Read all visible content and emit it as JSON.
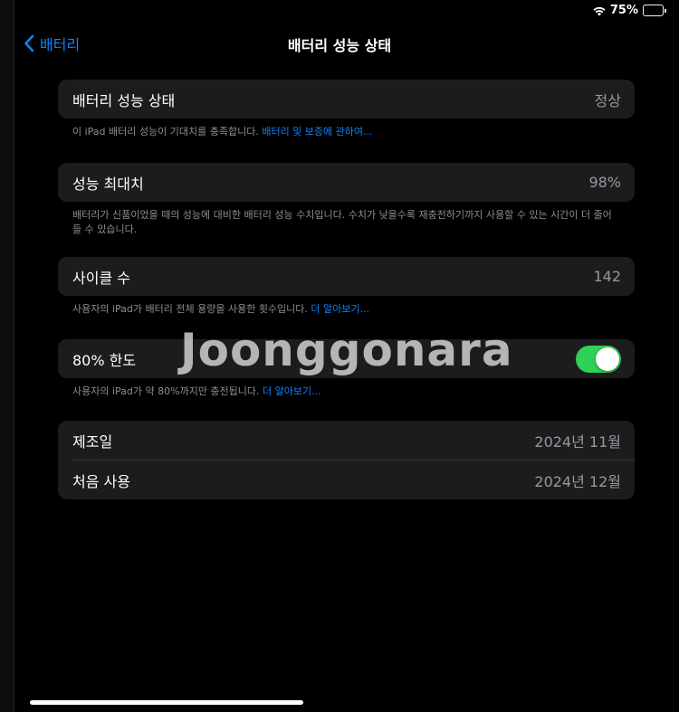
{
  "status_bar": {
    "battery_percent": "75%",
    "battery_level": 0.75
  },
  "nav": {
    "back_label": "배터리",
    "title": "배터리 성능 상태"
  },
  "health": {
    "label": "배터리 성능 상태",
    "value": "정상",
    "footnote": "이 iPad 배터리 성능이 기대치를 충족합니다.",
    "footnote_link": "배터리 및 보증에 관하여..."
  },
  "max_capacity": {
    "label": "성능 최대치",
    "value": "98%",
    "footnote": "배터리가 신품이었을 때의 성능에 대비한 배터리 성능 수치입니다. 수치가 낮을수록 재충전하기까지 사용할 수 있는 시간이 더 줄어들 수 있습니다."
  },
  "cycle_count": {
    "label": "사이클 수",
    "value": "142",
    "footnote": "사용자의 iPad가 배터리 전체 용량을 사용한 횟수입니다.",
    "footnote_link": "더 알아보기..."
  },
  "limit_80": {
    "label": "80% 한도",
    "enabled": true,
    "toggle_color": "#30d158",
    "footnote": "사용자의 iPad가 약 80%까지만 충전됩니다.",
    "footnote_link": "더 알아보기..."
  },
  "dates": {
    "manufacture_label": "제조일",
    "manufacture_value": "2024년 11월",
    "first_use_label": "처음 사용",
    "first_use_value": "2024년 12월"
  },
  "watermark": "Joonggonara",
  "colors": {
    "accent": "#0a84ff",
    "background": "#000000",
    "group_background": "#1c1c1e"
  }
}
